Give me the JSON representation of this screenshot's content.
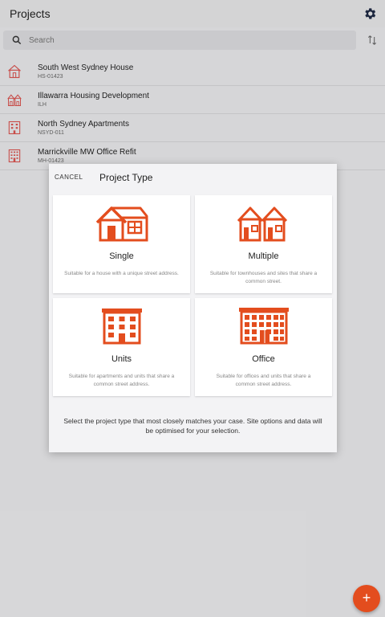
{
  "app": {
    "title": "Projects"
  },
  "search": {
    "placeholder": "Search"
  },
  "colors": {
    "accent": "#e34d1e",
    "icon_red": "#d9534f"
  },
  "projects": [
    {
      "name": "South West Sydney House",
      "code": "HS-01423",
      "icon": "house-icon"
    },
    {
      "name": "Illawarra Housing Development",
      "code": "ILH",
      "icon": "townhouse-icon"
    },
    {
      "name": "North Sydney Apartments",
      "code": "NSYD-011",
      "icon": "apartment-icon"
    },
    {
      "name": "Marrickville MW Office Refit",
      "code": "MH-01423",
      "icon": "office-icon"
    }
  ],
  "dialog": {
    "cancel_label": "CANCEL",
    "title": "Project Type",
    "options": [
      {
        "label": "Single",
        "description": "Suitable for a house with a unique street address.",
        "icon": "single-house-icon"
      },
      {
        "label": "Multiple",
        "description": "Suitable for townhouses and sites that share a common street.",
        "icon": "multiple-houses-icon"
      },
      {
        "label": "Units",
        "description": "Suitable for apartments and units that share a common street address.",
        "icon": "units-building-icon"
      },
      {
        "label": "Office",
        "description": "Suitable for offices and units that share a common street address.",
        "icon": "office-building-icon"
      }
    ],
    "help_text": "Select the project type that most closely matches your case. Site options and data will be optimised for your selection."
  },
  "fab": {
    "label": "+"
  }
}
